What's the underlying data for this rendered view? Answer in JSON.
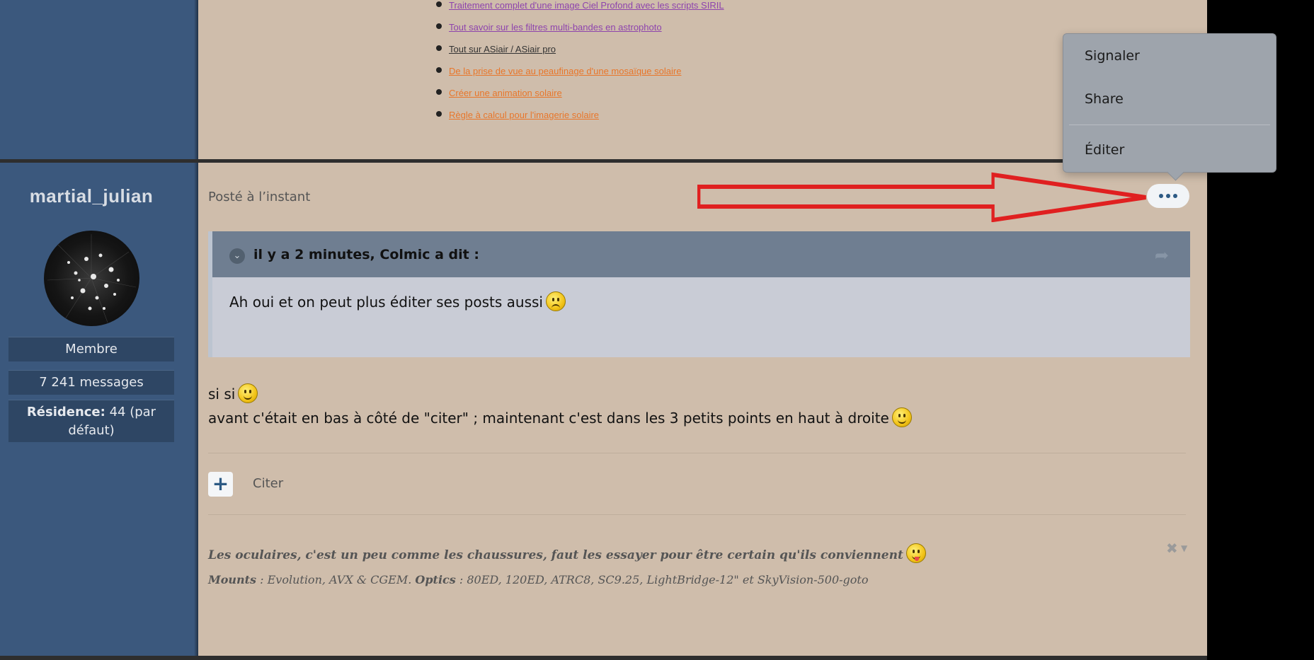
{
  "related_links": [
    {
      "label": "Traitement complet d'une image Ciel Profond avec les scripts SIRIL",
      "color": "#8e44ad"
    },
    {
      "label": "Tout savoir sur les filtres multi-bandes en astrophoto",
      "color": "#8e44ad"
    },
    {
      "label": "Tout sur ASiair / ASiair pro",
      "color": "#333333"
    },
    {
      "label": "De la prise de vue au peaufinage d'une mosaïque solaire",
      "color": "#e8762a"
    },
    {
      "label": "Créer une animation solaire",
      "color": "#e8762a"
    },
    {
      "label": "Règle à calcul pour l'imagerie solaire",
      "color": "#e8762a"
    }
  ],
  "author": {
    "name": "martial_julian",
    "role": "Membre",
    "messages": "7 241 messages",
    "residence_label": "Résidence:",
    "residence_value": " 44 (par défaut)"
  },
  "post": {
    "time": "Posté à l’instant",
    "quote": {
      "header": "il y a 2 minutes, Colmic a dit :",
      "text": "Ah oui et on peut plus éditer ses posts aussi"
    },
    "lines": [
      "si si",
      "avant c'était en bas à côté de \"citer\" ; maintenant c'est dans les 3 petits points en haut à droite"
    ],
    "cite_label": "Citer",
    "plus_label": "+",
    "signature": {
      "line1": "Les oculaires, c'est un peu comme les chaussures, faut les essayer pour être certain qu'ils conviennent",
      "mounts_label": "Mounts",
      "mounts_value": " : Evolution, AVX & CGEM. ",
      "optics_label": "Optics",
      "optics_value": " : 80ED, 120ED, ATRC8, SC9.25, LightBridge-12\" et  SkyVision-500-goto"
    }
  },
  "menu": {
    "items": [
      "Signaler",
      "Share",
      "Éditer"
    ]
  },
  "colors": {
    "sidebar": "#3b587d",
    "content_bg": "#cfbdab",
    "annotation_arrow": "#e02020",
    "accent": "#2d5a84"
  }
}
